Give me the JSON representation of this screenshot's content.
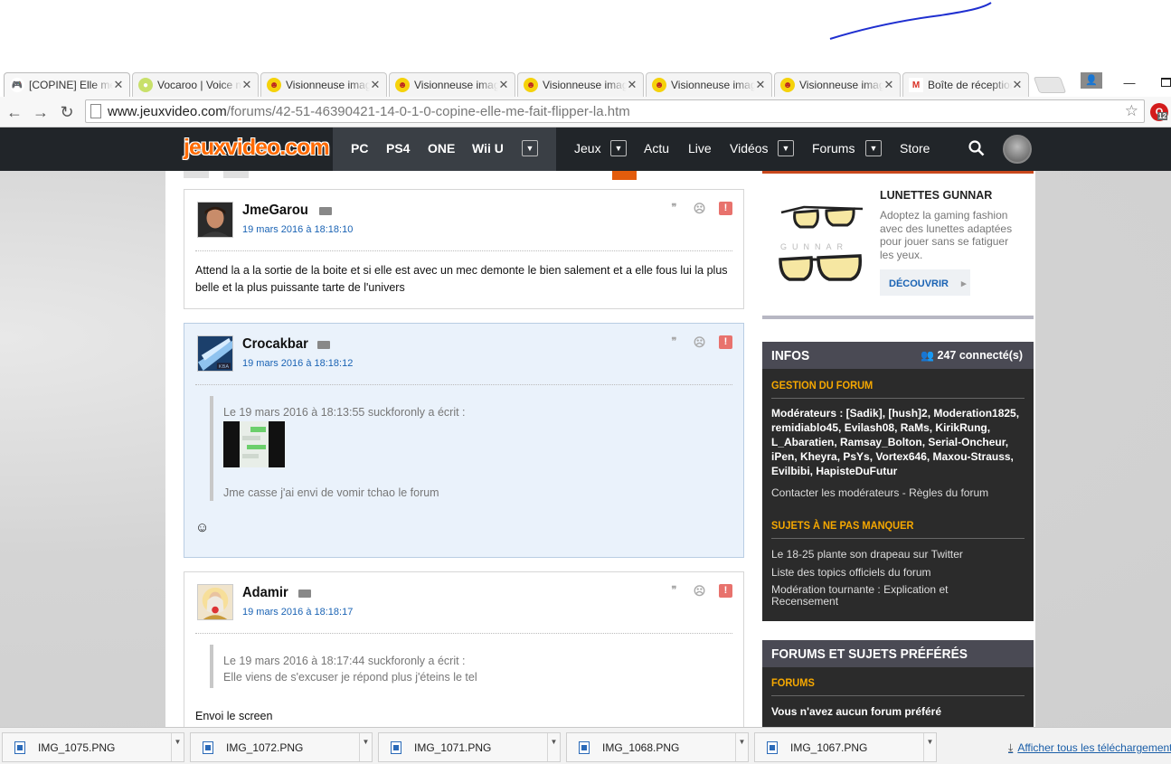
{
  "browser": {
    "tabs": [
      {
        "label": "[COPINE] Elle me fait flipper la",
        "icon": "gamepad-icon",
        "active": true
      },
      {
        "label": "Vocaroo | Voice message",
        "icon": "vocaroo-icon",
        "active": false
      },
      {
        "label": "Visionneuse images",
        "icon": "smiley-icon",
        "active": false
      },
      {
        "label": "Visionneuse images",
        "icon": "smiley-icon",
        "active": false
      },
      {
        "label": "Visionneuse images",
        "icon": "smiley-icon",
        "active": false
      },
      {
        "label": "Visionneuse images",
        "icon": "smiley-icon",
        "active": false
      },
      {
        "label": "Visionneuse images",
        "icon": "smiley-icon",
        "active": false
      },
      {
        "label": "Boîte de réception",
        "icon": "gmail-icon",
        "active": false
      }
    ],
    "close_glyph": "✕",
    "url_host": "www.jeuxvideo.com",
    "url_path": "/forums/42-51-46390421-14-0-1-0-copine-elle-me-fait-flipper-la.htm",
    "extension_badge": "12"
  },
  "site": {
    "logo": "jeuxvideo.com",
    "platforms": [
      "PC",
      "PS4",
      "ONE",
      "Wii U"
    ],
    "menu": {
      "jeux": "Jeux",
      "actu": "Actu",
      "live": "Live",
      "videos": "Vidéos",
      "forums": "Forums",
      "store": "Store"
    }
  },
  "posts": [
    {
      "author": "JmeGarou",
      "date": "19 mars 2016 à 18:18:10",
      "text": "Attend la a la sortie de la boite et si elle est avec un mec demonte le bien salement et a elle fous lui la plus belle et la plus puissante tarte de l'univers"
    },
    {
      "author": "Crocakbar",
      "date": "19 mars 2016 à 18:18:12",
      "quote_header": "Le 19 mars 2016 à 18:13:55 suckforonly a écrit :",
      "quote_text": "Jme casse j'ai envi de vomir tchao le forum",
      "text": ""
    },
    {
      "author": "Adamir",
      "date": "19 mars 2016 à 18:18:17",
      "quote_header": "Le 19 mars 2016 à 18:17:44 suckforonly a écrit :",
      "quote_text": "Elle viens de s'excuser je répond plus j'éteins le tel",
      "text": "Envoi le screen"
    }
  ],
  "ad": {
    "title": "LUNETTES GUNNAR",
    "text": "Adoptez la gaming fashion avec des lunettes adaptées pour jouer sans se fatiguer les yeux.",
    "button": "DÉCOUVRIR",
    "brand": "GUNNAR"
  },
  "infos": {
    "title": "INFOS",
    "connected": "247 connecté(s)",
    "gestion_title": "GESTION DU FORUM",
    "moderators": "Modérateurs : [Sadik], [hush]2, Moderation1825, remidiablo45, Evilash08, RaMs, KirikRung, L_Abaratien, Ramsay_Bolton, Serial-Oncheur, iPen, Kheyra, PsYs, Vortex646, Maxou-Strauss, Evilbibi, HapisteDuFutur",
    "contact": "Contacter les modérateurs",
    "dash": "-",
    "rules": "Règles du forum",
    "sujets_title": "SUJETS À NE PAS MANQUER",
    "sujets": [
      "Le 18-25 plante son drapeau sur Twitter",
      "Liste des topics officiels du forum",
      "Modération tournante : Explication et Recensement"
    ]
  },
  "favorites": {
    "title": "FORUMS ET SUJETS PRÉFÉRÉS",
    "forums_title": "FORUMS",
    "empty": "Vous n'avez aucun forum préféré"
  },
  "downloads": {
    "items": [
      "IMG_1075.PNG",
      "IMG_1072.PNG",
      "IMG_1071.PNG",
      "IMG_1068.PNG",
      "IMG_1067.PNG"
    ],
    "show_all": "Afficher tous les téléchargements"
  },
  "colors": {
    "accent": "#ff6a00",
    "link": "#1a63b4",
    "sidebar_section": "#f6a800",
    "header_bg": "#212529"
  }
}
